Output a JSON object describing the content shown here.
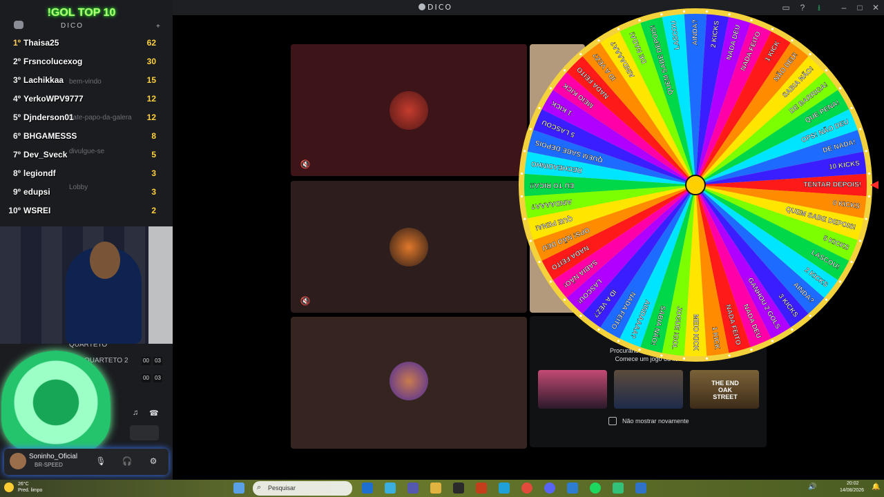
{
  "app": {
    "title": "DICO"
  },
  "ranking": {
    "title": "!GOL TOP 10",
    "server_name": "DICO",
    "rows": [
      {
        "pos": "1º",
        "name": "Thaisa25",
        "score": "62"
      },
      {
        "pos": "2º",
        "name": "Frsncolucexog",
        "score": "30"
      },
      {
        "pos": "3º",
        "name": "Lachikkaa",
        "score": "15"
      },
      {
        "pos": "4º",
        "name": "YerkoWPV9777",
        "score": "12"
      },
      {
        "pos": "5º",
        "name": "Djnderson01",
        "score": "12"
      },
      {
        "pos": "6º",
        "name": "BHGAMESSS",
        "score": "8"
      },
      {
        "pos": "7º",
        "name": "Dev_Sveck",
        "score": "5"
      },
      {
        "pos": "8º",
        "name": "legiondf",
        "score": "3"
      },
      {
        "pos": "9º",
        "name": "edupsi",
        "score": "3"
      },
      {
        "pos": "10º",
        "name": "WSREI",
        "score": "2"
      }
    ]
  },
  "channels": {
    "bem_vindo": "bem-vindo",
    "bate_papo": "bate-papo-da-galera",
    "divulgue": "divulgue-se",
    "lobby": "Lobby",
    "quarteto": "QUARTETO",
    "quarteto2": "QUARTETO 2",
    "badge_00": "00",
    "badge_03": "03"
  },
  "user": {
    "name": "Soninho_Oficial",
    "status": "BR-SPEED"
  },
  "activity": {
    "title": "Procurando algo para jogar?",
    "subtitle": "Comece um jogo ou lista",
    "dont_show": "Não mostrar novamente",
    "games": [
      "",
      "",
      "THE END OAK STREET"
    ]
  },
  "wheel": {
    "labels": [
      "TENTAR DEPOIS!",
      "0 KICKS",
      "QUEM SABE DEPOIS!",
      "5 KICKS",
      "LASCOU!",
      "2 KICKS",
      "AINDA?",
      "3 KICKS",
      "GANHOU 2 GOLS",
      "NADA DEU",
      "NADA FEITO",
      "1 KICK",
      "MEIO KICK",
      "JOGUE !GOL",
      "SABIA NÃO!",
      "AINDAAAA?",
      "NADA FEITO",
      "ID A VEZ?",
      "LASCOU!",
      "SABIA NÃO!",
      "NADA FEITO",
      "OPS! NÃO DEU",
      "QUE PENA!",
      "AINDAAAA?",
      "EU TO RICA!!",
      "RECHEADINHO",
      "QUEM SABE DEPOIS",
      "5 LASCOU",
      "1 KICK",
      "MEIO KICK",
      "NADA FEITO",
      "ID A VEZ?",
      "AINDAAAA?",
      "DE NADA!",
      "QUEM SABE DEPOIS!",
      "LASCOU",
      "AINDA?",
      "2 KICKS",
      "NADA DEU",
      "NADA FEITO",
      "1 KICK",
      "NÃO DEU!",
      "SABIA NÃO!",
      "DE BARRIGA!",
      "QUE PENA!",
      "OPS! NÃO DEU",
      "DE NADA!",
      "10 KICKS"
    ]
  },
  "taskbar": {
    "temp": "26°C",
    "weather": "Pred. limpo",
    "search": "Pesquisar",
    "time": "20:02",
    "date": "14/08/2026"
  },
  "colors": {
    "tile1": "#3d1518",
    "tile2": "#2d1d1c",
    "tile3": "#35241f",
    "wheel_rim": "#f4d23c",
    "wheel_hub": "#ffd000"
  }
}
